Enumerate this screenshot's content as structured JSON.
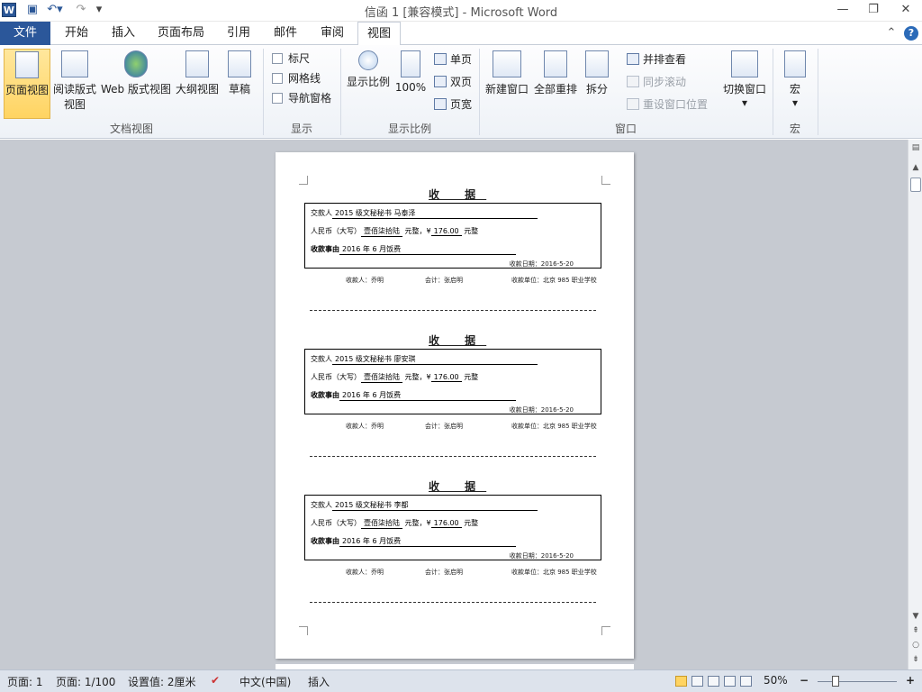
{
  "titlebar": {
    "title": "信函 1 [兼容模式] - Microsoft Word",
    "word_icon": "W",
    "save_icon": "floppy-icon",
    "undo_icon": "undo-icon",
    "redo_icon": "redo-icon",
    "min": "—",
    "max": "❐",
    "close": "✕"
  },
  "tabs": {
    "file": "文件",
    "home": "开始",
    "insert": "插入",
    "layout": "页面布局",
    "references": "引用",
    "mailings": "邮件",
    "review": "审阅",
    "view": "视图"
  },
  "ribbon": {
    "doc_views": {
      "page_view": "页面视图",
      "reading_l1": "阅读版式",
      "reading_l2": "视图",
      "web": "Web 版式视图",
      "outline": "大纲视图",
      "draft": "草稿",
      "group": "文档视图"
    },
    "show": {
      "ruler": "标尺",
      "gridlines": "网格线",
      "nav": "导航窗格",
      "group": "显示"
    },
    "zoom": {
      "zoom": "显示比例",
      "hundred": "100%",
      "one_page": "单页",
      "two_pages": "双页",
      "page_width": "页宽",
      "group": "显示比例"
    },
    "window": {
      "new_window": "新建窗口",
      "arrange_all": "全部重排",
      "split": "拆分",
      "side_by_side": "并排查看",
      "sync_scroll": "同步滚动",
      "reset_pos": "重设窗口位置",
      "switch": "切换窗口",
      "group": "窗口"
    },
    "macros": {
      "macro": "宏",
      "group": "宏"
    }
  },
  "receipt_common": {
    "title": "收 据",
    "payer_label": "交款人",
    "rmb_label": "人民币（大写）",
    "amount_cn": "壹佰柒拾陆",
    "yuan": "元整，¥",
    "amount": "176.00",
    "yuan2": "元整",
    "reason_label": "收款事由",
    "reason": "2016 年 6 月饭费",
    "date": "收款日期：2016-5-20",
    "receiver": "收款人：乔明",
    "accountant": "会计：张启明",
    "unit": "收款单位：北京 985 职业学校"
  },
  "receipts": [
    {
      "payer": "2015 级文秘秘书 马泰泽"
    },
    {
      "payer": "2015 级文秘秘书 廖安琪"
    },
    {
      "payer": "2015 级文秘秘书 李都"
    }
  ],
  "status": {
    "page": "页面: 1",
    "pages": "页面: 1/100",
    "setting": "设置值: 2厘米",
    "lang": "中文(中国)",
    "insert": "插入",
    "zoom": "50%",
    "minus": "−",
    "plus": "+"
  }
}
